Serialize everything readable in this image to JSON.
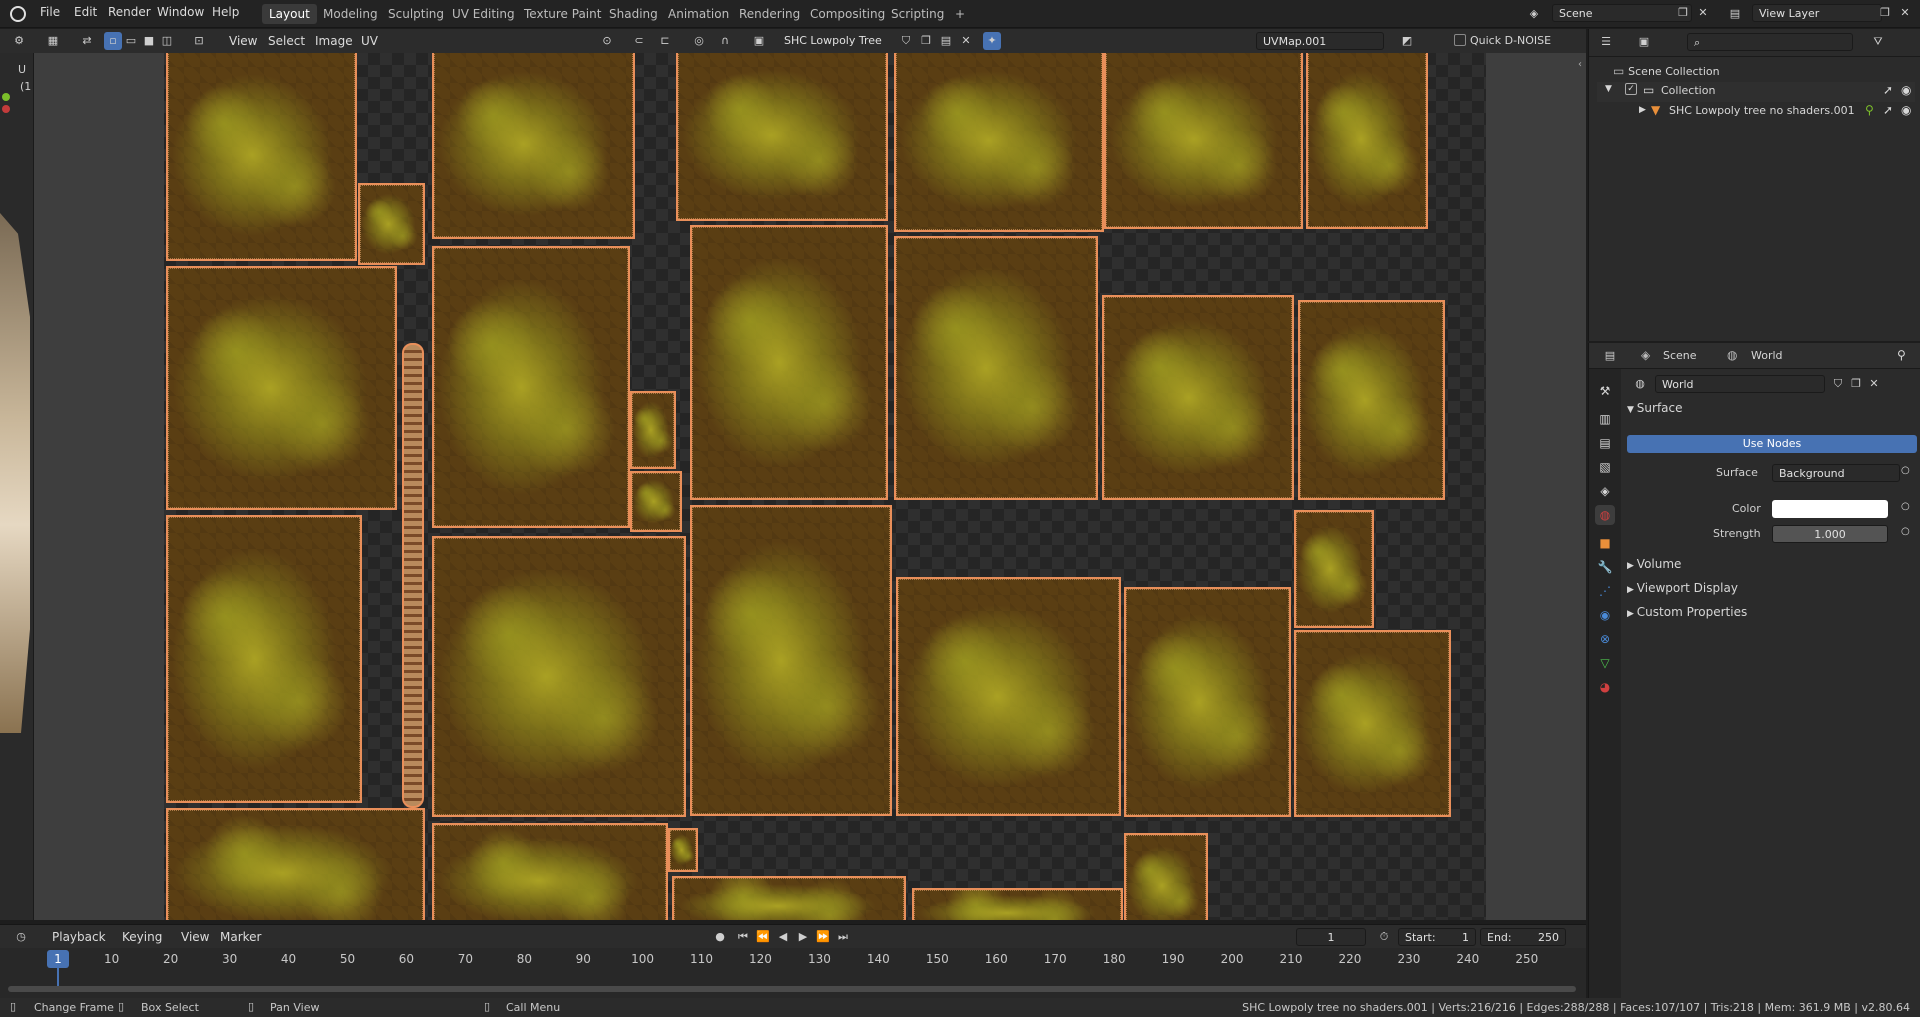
{
  "topbar": {
    "menus": [
      "File",
      "Edit",
      "Render",
      "Window",
      "Help"
    ],
    "workspaces": [
      "Layout",
      "Modeling",
      "Sculpting",
      "UV Editing",
      "Texture Paint",
      "Shading",
      "Animation",
      "Rendering",
      "Compositing",
      "Scripting"
    ],
    "active_workspace": "Layout",
    "add_tab": "+",
    "scene": "Scene",
    "view_layer": "View Layer"
  },
  "uv_header": {
    "menus": [
      "View",
      "Select",
      "Image",
      "UV"
    ],
    "image_name": "SHC Lowpoly Tree",
    "uvmap": "UVMap.001",
    "denoise": "Quick D-NOISE"
  },
  "timeline": {
    "menus": [
      "Playback",
      "Keying",
      "View",
      "Marker"
    ],
    "current_frame": "1",
    "start_label": "Start:",
    "start": "1",
    "end_label": "End:",
    "end": "250",
    "ticks": [
      "1",
      "10",
      "20",
      "30",
      "40",
      "50",
      "60",
      "70",
      "80",
      "90",
      "100",
      "110",
      "120",
      "130",
      "140",
      "150",
      "160",
      "170",
      "180",
      "190",
      "200",
      "210",
      "220",
      "230",
      "240",
      "250"
    ]
  },
  "status": {
    "change_frame": "Change Frame",
    "box_select": "Box Select",
    "pan_view": "Pan View",
    "call_menu": "Call Menu",
    "info": "SHC Lowpoly tree no shaders.001 | Verts:216/216 | Edges:288/288 | Faces:107/107 | Tris:218 | Mem: 361.9 MB | v2.80.64"
  },
  "outliner": {
    "scene_collection": "Scene Collection",
    "collection": "Collection",
    "object": "SHC Lowpoly tree no shaders.001"
  },
  "properties": {
    "breadcrumb_scene": "Scene",
    "breadcrumb_world": "World",
    "world_name": "World",
    "surface_panel": "Surface",
    "use_nodes": "Use Nodes",
    "surface_label": "Surface",
    "surface_value": "Background",
    "color_label": "Color",
    "strength_label": "Strength",
    "strength_value": "1.000",
    "volume_panel": "Volume",
    "viewport_display_panel": "Viewport Display",
    "custom_properties_panel": "Custom Properties"
  },
  "left_edge": {
    "u_label": "U",
    "paren_label": "(1"
  },
  "colors": {
    "accent": "#4772b3",
    "island_outline": "#e98f5a",
    "foliage": "#b7b226"
  }
}
